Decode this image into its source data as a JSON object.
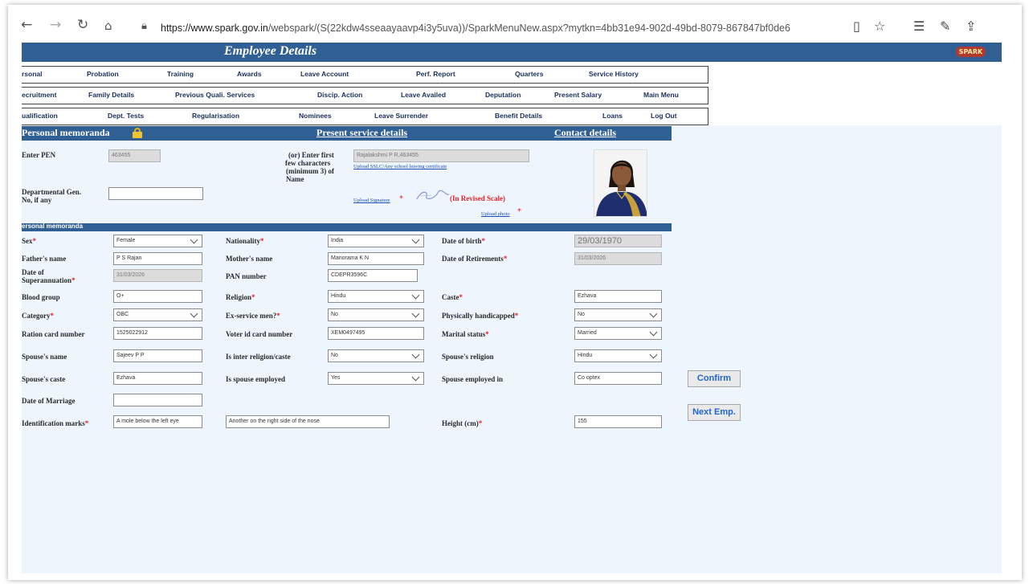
{
  "browser": {
    "url_host": "https://www.spark.gov.in",
    "url_path": "/webspark/(S(22kdw4sseaayaavp4i3y5uva))/SparkMenuNew.aspx?mytkn=4bb31e94-902d-49bd-8079-867847bf0de6"
  },
  "page_title": "Employee Details",
  "menu": {
    "row1": [
      "rsonal",
      "Probation",
      "Training",
      "Awards",
      "Leave Account",
      "Perf. Report",
      "Quarters",
      "Service History"
    ],
    "row2": [
      "ecruitment",
      "Family Details",
      "Previous Quali. Services",
      "Discip. Action",
      "Leave Availed",
      "Deputation",
      "Present Salary",
      "Main Menu"
    ],
    "row3": [
      "ualification",
      "Dept. Tests",
      "Regularisation",
      "Nominees",
      "Leave Surrender",
      "Benefit Details",
      "Loans",
      "Log Out"
    ]
  },
  "header": {
    "personal": "Personal memoranda",
    "service": "Present service details",
    "contact": "Contact details"
  },
  "search": {
    "pen_label": "Enter PEN",
    "pen_value": "463455",
    "name_label_1": "(or)  Enter first",
    "name_label_2": "few characters",
    "name_label_3": "(minimum 3) of",
    "name_label_4": "Name",
    "name_value": "Rajalakshmi P R,463455",
    "upload_sslc": "Upload SSLC/Any school leaving certificate",
    "gen_label_1": "Departmental  Gen.",
    "gen_label_2": "No, if any",
    "upload_signature": "Upload Signature",
    "revised_scale": "(In Revised Scale)",
    "upload_photo": "Upload photo",
    "asterisk": "*"
  },
  "subheader": "ersonal memoranda",
  "fields": {
    "sex": {
      "label": "Sex",
      "value": "Female"
    },
    "nationality": {
      "label": "Nationality",
      "value": "India"
    },
    "dob": {
      "label": "Date of birth",
      "value": "29/03/1970"
    },
    "father": {
      "label": "Father's name",
      "value": "P S Rajan"
    },
    "mother": {
      "label": "Mother's name",
      "value": "Manorama K N"
    },
    "retirement": {
      "label": "Date of Retirements",
      "value": "31/03/2026"
    },
    "superannuation": {
      "label1": "Date of",
      "label2": "Superannuation",
      "value": "31/03/2026"
    },
    "pan": {
      "label": "PAN number",
      "value": "CDEPR3596C"
    },
    "blood": {
      "label": "Blood group",
      "value": "O+"
    },
    "religion": {
      "label": "Religion",
      "value": "Hindu"
    },
    "caste": {
      "label": "Caste",
      "value": "Ezhava"
    },
    "category": {
      "label": "Category",
      "value": "OBC"
    },
    "exservice": {
      "label": "Ex-service men?",
      "value": "No"
    },
    "handicapped": {
      "label": "Physically handicapped",
      "value": "No"
    },
    "ration": {
      "label": "Ration card number",
      "value": "1525022912"
    },
    "voter": {
      "label": "Voter id card number",
      "value": "XEM0497495"
    },
    "marital": {
      "label": "Marital status",
      "value": "Married"
    },
    "spouse_name": {
      "label": "Spouse's name",
      "value": "Sajeev P P"
    },
    "inter_religion": {
      "label": "Is inter religion/caste",
      "value": "No"
    },
    "spouse_religion": {
      "label": "Spouse's religion",
      "value": "Hindu"
    },
    "spouse_caste": {
      "label": "Spouse's caste",
      "value": "Ezhava"
    },
    "spouse_employed": {
      "label": "Is spouse employed",
      "value": "Yes"
    },
    "spouse_employed_in": {
      "label": "Spouse employed in",
      "value": "Co optex"
    },
    "marriage_date": {
      "label": "Date of Marriage",
      "value": ""
    },
    "id_marks": {
      "label": "Identification marks",
      "value1": "A mole below the left eye",
      "value2": "Another on the right side of the nose"
    },
    "height": {
      "label": "Height (cm)",
      "value": "155"
    }
  },
  "buttons": {
    "confirm": "Confirm",
    "next": "Next Emp."
  },
  "logo_text": "SPARK",
  "colors": {
    "accent": "#2f5f93",
    "form_bg": "#eef5fd",
    "required": "#e0242a",
    "link": "#1a4fb8"
  }
}
